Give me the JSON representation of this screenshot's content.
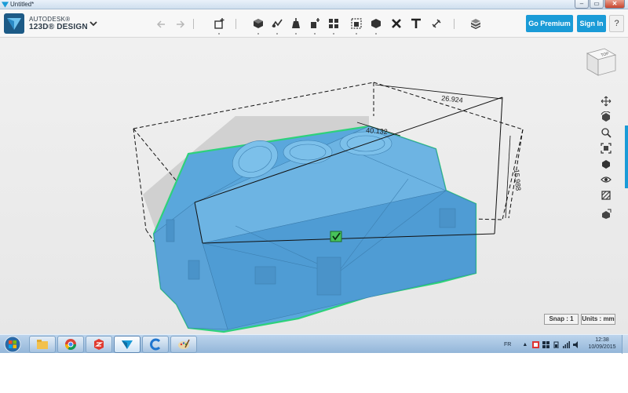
{
  "window": {
    "title": "Untitled*",
    "controls": {
      "minimize": "–",
      "maximize": "▭",
      "close": "✕"
    }
  },
  "brand": {
    "line1": "AUTODESK®",
    "line2": "123D® DESIGN"
  },
  "toolbar": {
    "menu_icon": "chevron-down-icon",
    "undo_icon": "undo-icon",
    "redo_icon": "redo-icon",
    "tools": [
      "transform-icon",
      "primitives-icon",
      "sketch-icon",
      "construct-icon",
      "modify-icon",
      "pattern-icon",
      "grouping-icon",
      "combine-icon",
      "measure-icon",
      "text-icon",
      "snap-icon",
      "material-icon"
    ],
    "go_premium": "Go Premium",
    "sign_in": "Sign In",
    "help": "?"
  },
  "viewport": {
    "dimensions": {
      "width": "26.924",
      "depth": "40.132",
      "height": "15.988"
    },
    "selection_icon": "checkmark-icon",
    "snap_label": "Snap : 1",
    "units_label": "Units : mm",
    "viewcube_label": "TOP",
    "nav_tools": [
      "pan-icon",
      "orbit-icon",
      "zoom-icon",
      "fit-icon",
      "view-mode-icon",
      "visibility-icon",
      "materials-icon",
      "render-icon"
    ]
  },
  "taskbar": {
    "apps": [
      "windows-start-icon",
      "explorer-icon",
      "chrome-icon",
      "sketchup-icon",
      "123d-design-icon",
      "ccleaner-icon",
      "paint-icon"
    ],
    "language": "FR",
    "time": "12:38",
    "date": "10/09/2015"
  },
  "colors": {
    "accent": "#1a9bd7",
    "model": "#5aa7dc",
    "model_outline": "#2ed17c",
    "bbox": "#111111"
  }
}
